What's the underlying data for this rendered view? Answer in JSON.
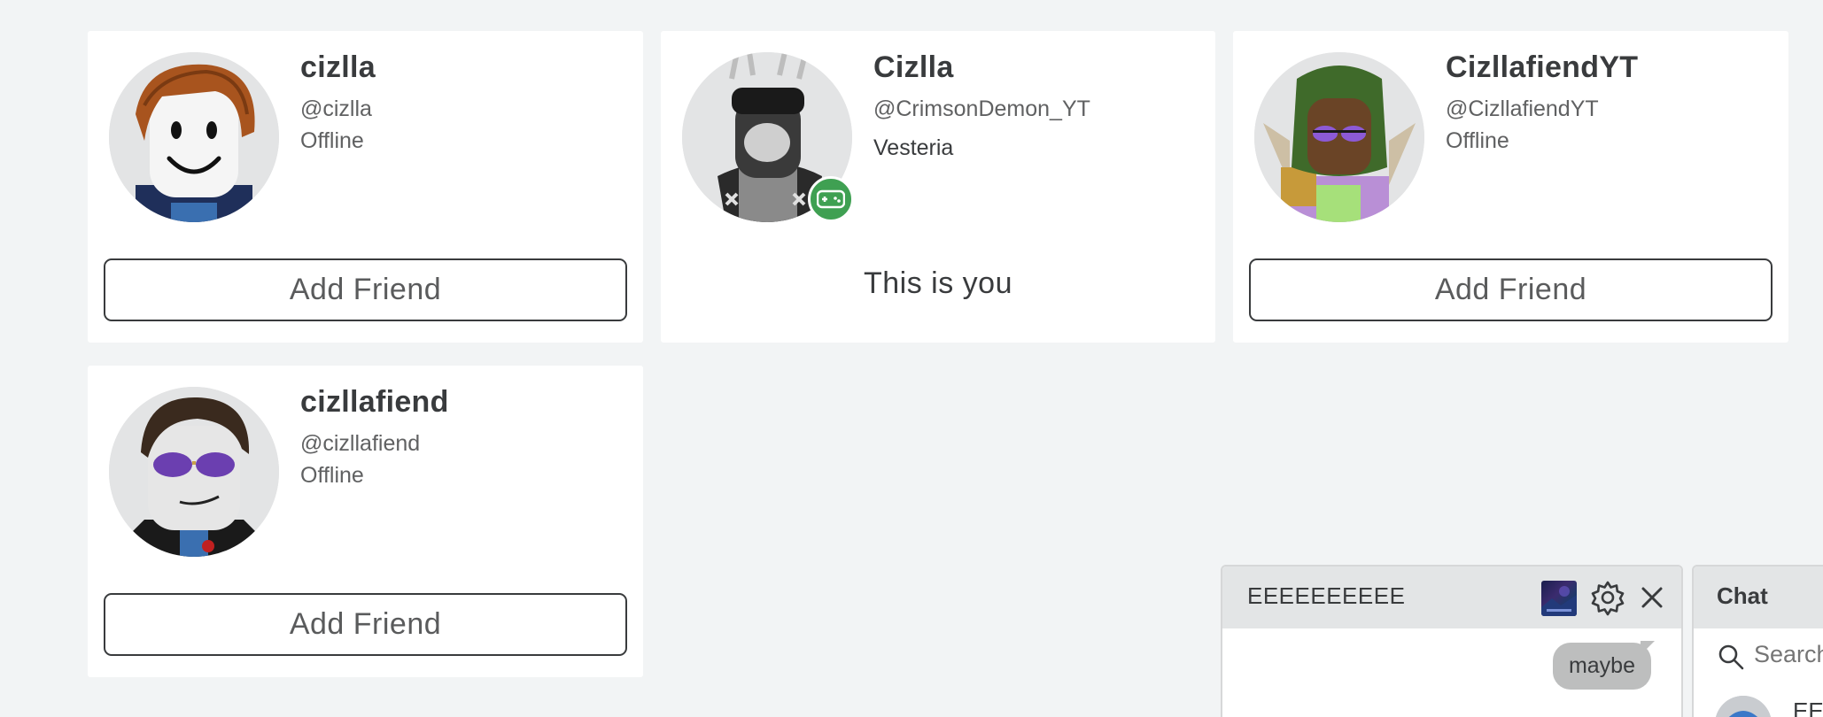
{
  "cards": [
    {
      "name": "cizlla",
      "handle": "@cizlla",
      "status": "Offline",
      "button": "Add Friend"
    },
    {
      "name": "Cizlla",
      "handle": "@CrimsonDemon_YT",
      "status": "Vesteria",
      "self_label": "This is you"
    },
    {
      "name": "CizllafiendYT",
      "handle": "@CizllafiendYT",
      "status": "Offline",
      "button": "Add Friend"
    },
    {
      "name": "cizllafiend",
      "handle": "@cizllafiend",
      "status": "Offline",
      "button": "Add Friend"
    }
  ],
  "conversation": {
    "title": "EEEEEEEEEE",
    "messages": [
      {
        "text": "maybe",
        "from": "other"
      }
    ]
  },
  "chat": {
    "title": "Chat",
    "search_placeholder": "Search",
    "friend_partial": "EE"
  },
  "colors": {
    "background": "#f2f4f5",
    "card": "#ffffff",
    "in_game_badge": "#3fa052",
    "chat_header": "#e3e5e6"
  },
  "icons": [
    "controller-icon",
    "gear-icon",
    "close-icon",
    "search-icon"
  ]
}
